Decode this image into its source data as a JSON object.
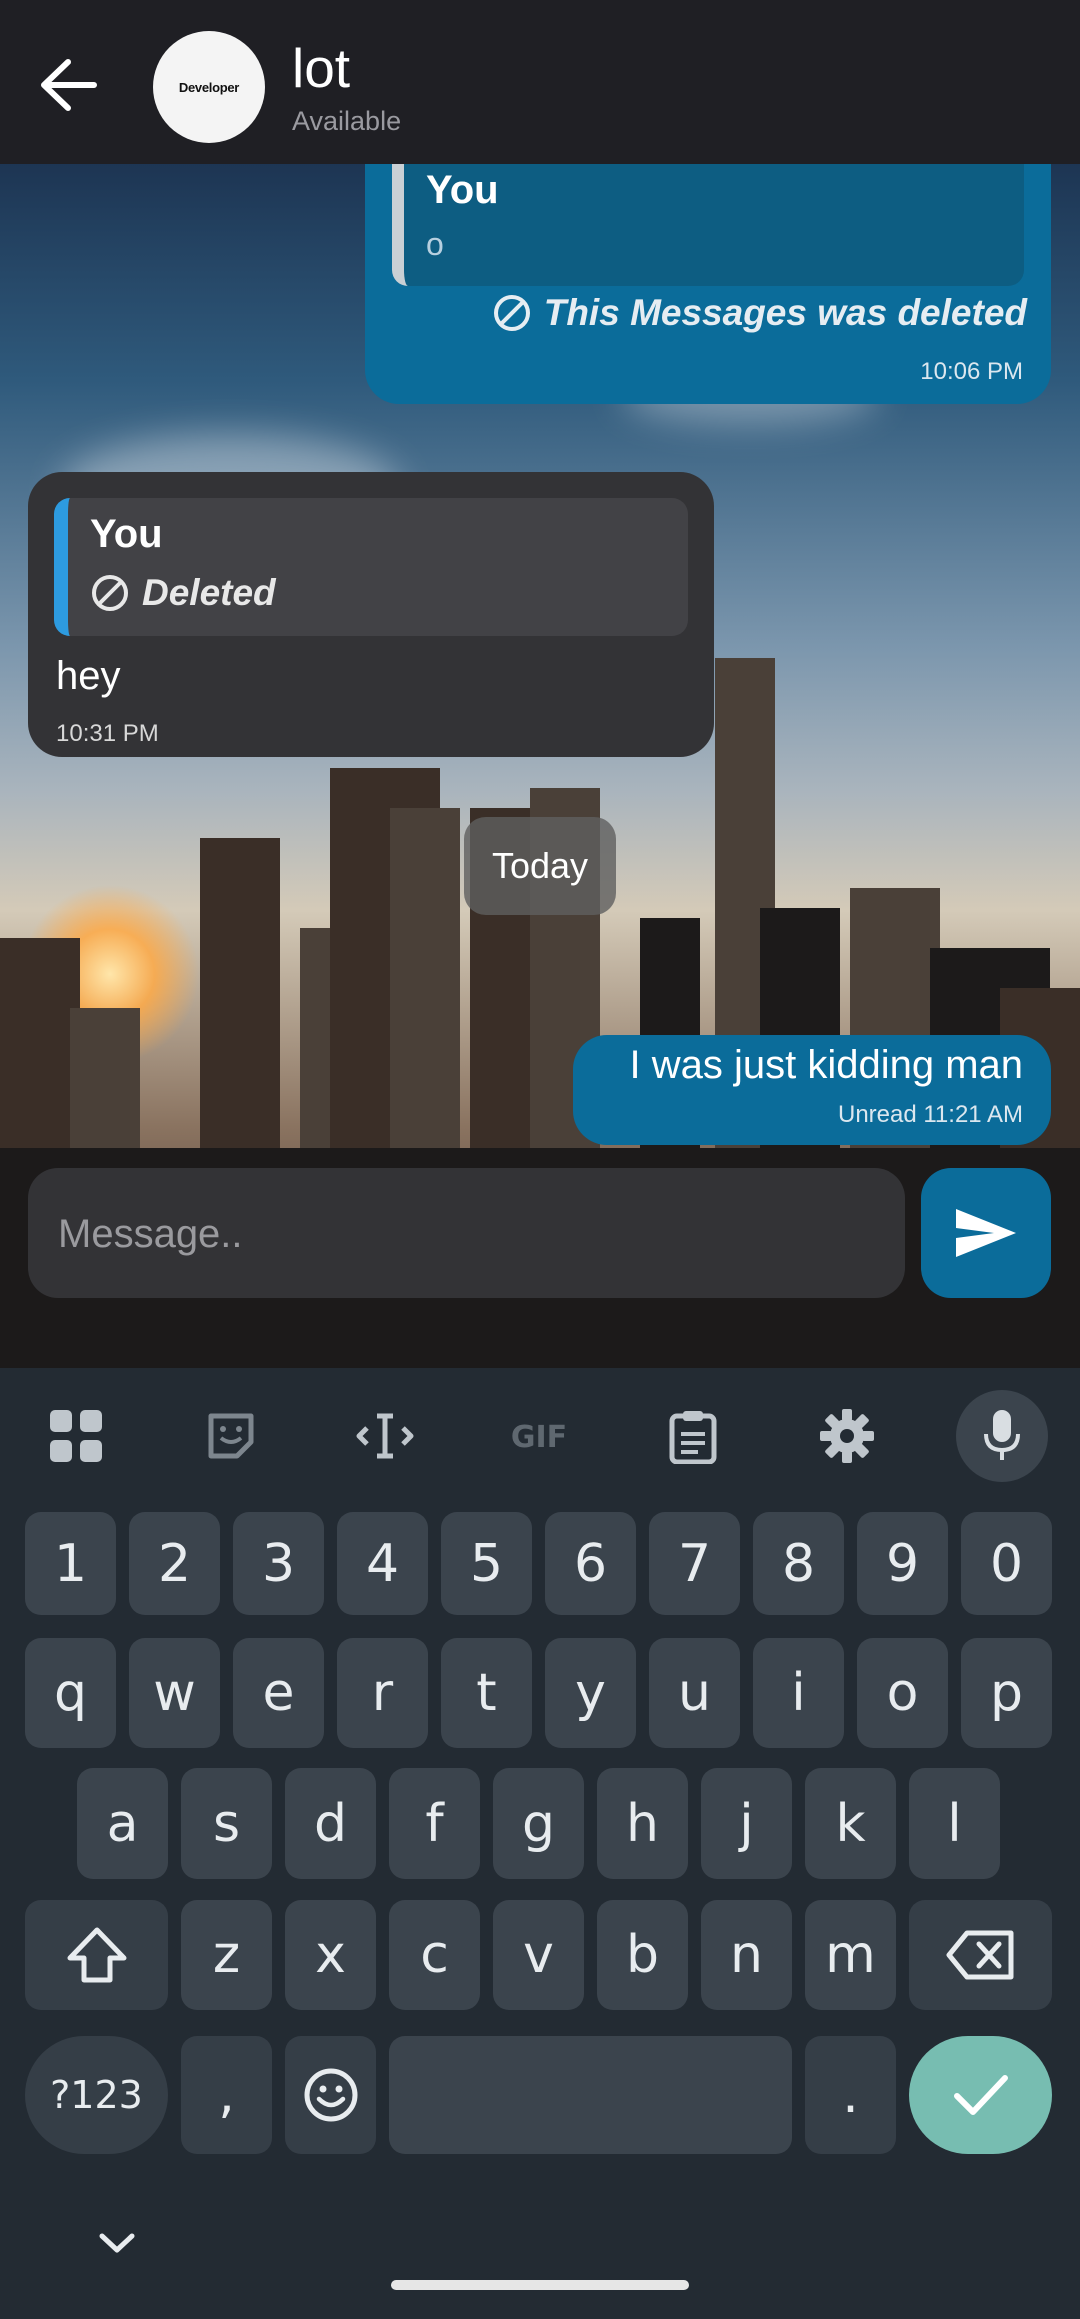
{
  "header": {
    "back_icon": "arrow-left-icon",
    "avatar_text": "Developer",
    "contact_name": "lot",
    "contact_status": "Available"
  },
  "messages": {
    "msg1": {
      "direction": "outgoing",
      "reply_name": "You",
      "reply_text": "o",
      "text": "This Messages was deleted",
      "icon": "blocked-icon",
      "time": "10:06 PM"
    },
    "msg2": {
      "direction": "incoming",
      "reply_name": "You",
      "reply_text": "Deleted",
      "icon": "blocked-icon",
      "text": "hey",
      "time": "10:31 PM"
    },
    "date_separator": "Today",
    "msg3": {
      "direction": "outgoing",
      "text": "I was just kidding man",
      "meta": "Unread 11:21 AM"
    }
  },
  "composer": {
    "placeholder": "Message..",
    "send_icon": "send-icon"
  },
  "keyboard": {
    "toolbar_icons": [
      "apps-grid-icon",
      "sticker-icon",
      "text-cursor-icon",
      "gif-icon",
      "clipboard-icon",
      "settings-gear-icon",
      "microphone-icon"
    ],
    "number_row": [
      "1",
      "2",
      "3",
      "4",
      "5",
      "6",
      "7",
      "8",
      "9",
      "0"
    ],
    "row1": [
      "q",
      "w",
      "e",
      "r",
      "t",
      "y",
      "u",
      "i",
      "o",
      "p"
    ],
    "row2": [
      "a",
      "s",
      "d",
      "f",
      "g",
      "h",
      "j",
      "k",
      "l"
    ],
    "row3": [
      "z",
      "x",
      "c",
      "v",
      "b",
      "n",
      "m"
    ],
    "symbols_key": "?123",
    "comma_key": ",",
    "period_key": ".",
    "colors": {
      "accent": "#0b6c9a",
      "ok_key": "#77bdb1",
      "key": "#3b444d",
      "bg": "#232b33"
    }
  }
}
